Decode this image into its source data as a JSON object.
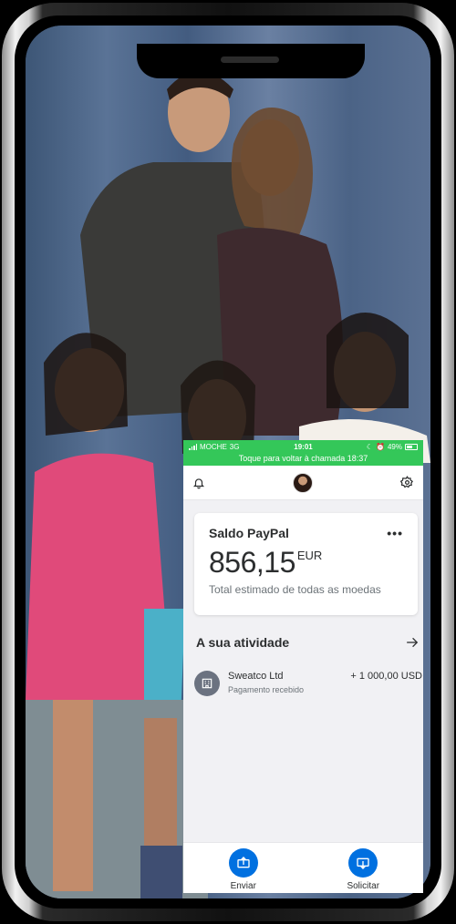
{
  "status_bar": {
    "carrier": "MOCHE",
    "network": "3G",
    "time": "19:01",
    "battery": "49%",
    "battery_level": 0.49,
    "call_banner": "Toque para voltar à chamada 18:37"
  },
  "header": {
    "left_icon": "bell-icon",
    "right_icon": "gear-icon"
  },
  "balance_card": {
    "title": "Saldo PayPal",
    "amount": "856,15",
    "currency": "EUR",
    "subtitle": "Total estimado de todas as moedas"
  },
  "activity": {
    "title": "A sua atividade",
    "transactions": [
      {
        "name": "Sweatco Ltd",
        "subtitle": "Pagamento recebido",
        "amount": "+ 1 000,00 USD",
        "icon": "building-icon"
      }
    ]
  },
  "bottom_nav": {
    "send_label": "Enviar",
    "request_label": "Solicitar"
  },
  "colors": {
    "status_green": "#34c759",
    "paypal_blue": "#0070e0",
    "app_background": "#f1f1f4"
  }
}
